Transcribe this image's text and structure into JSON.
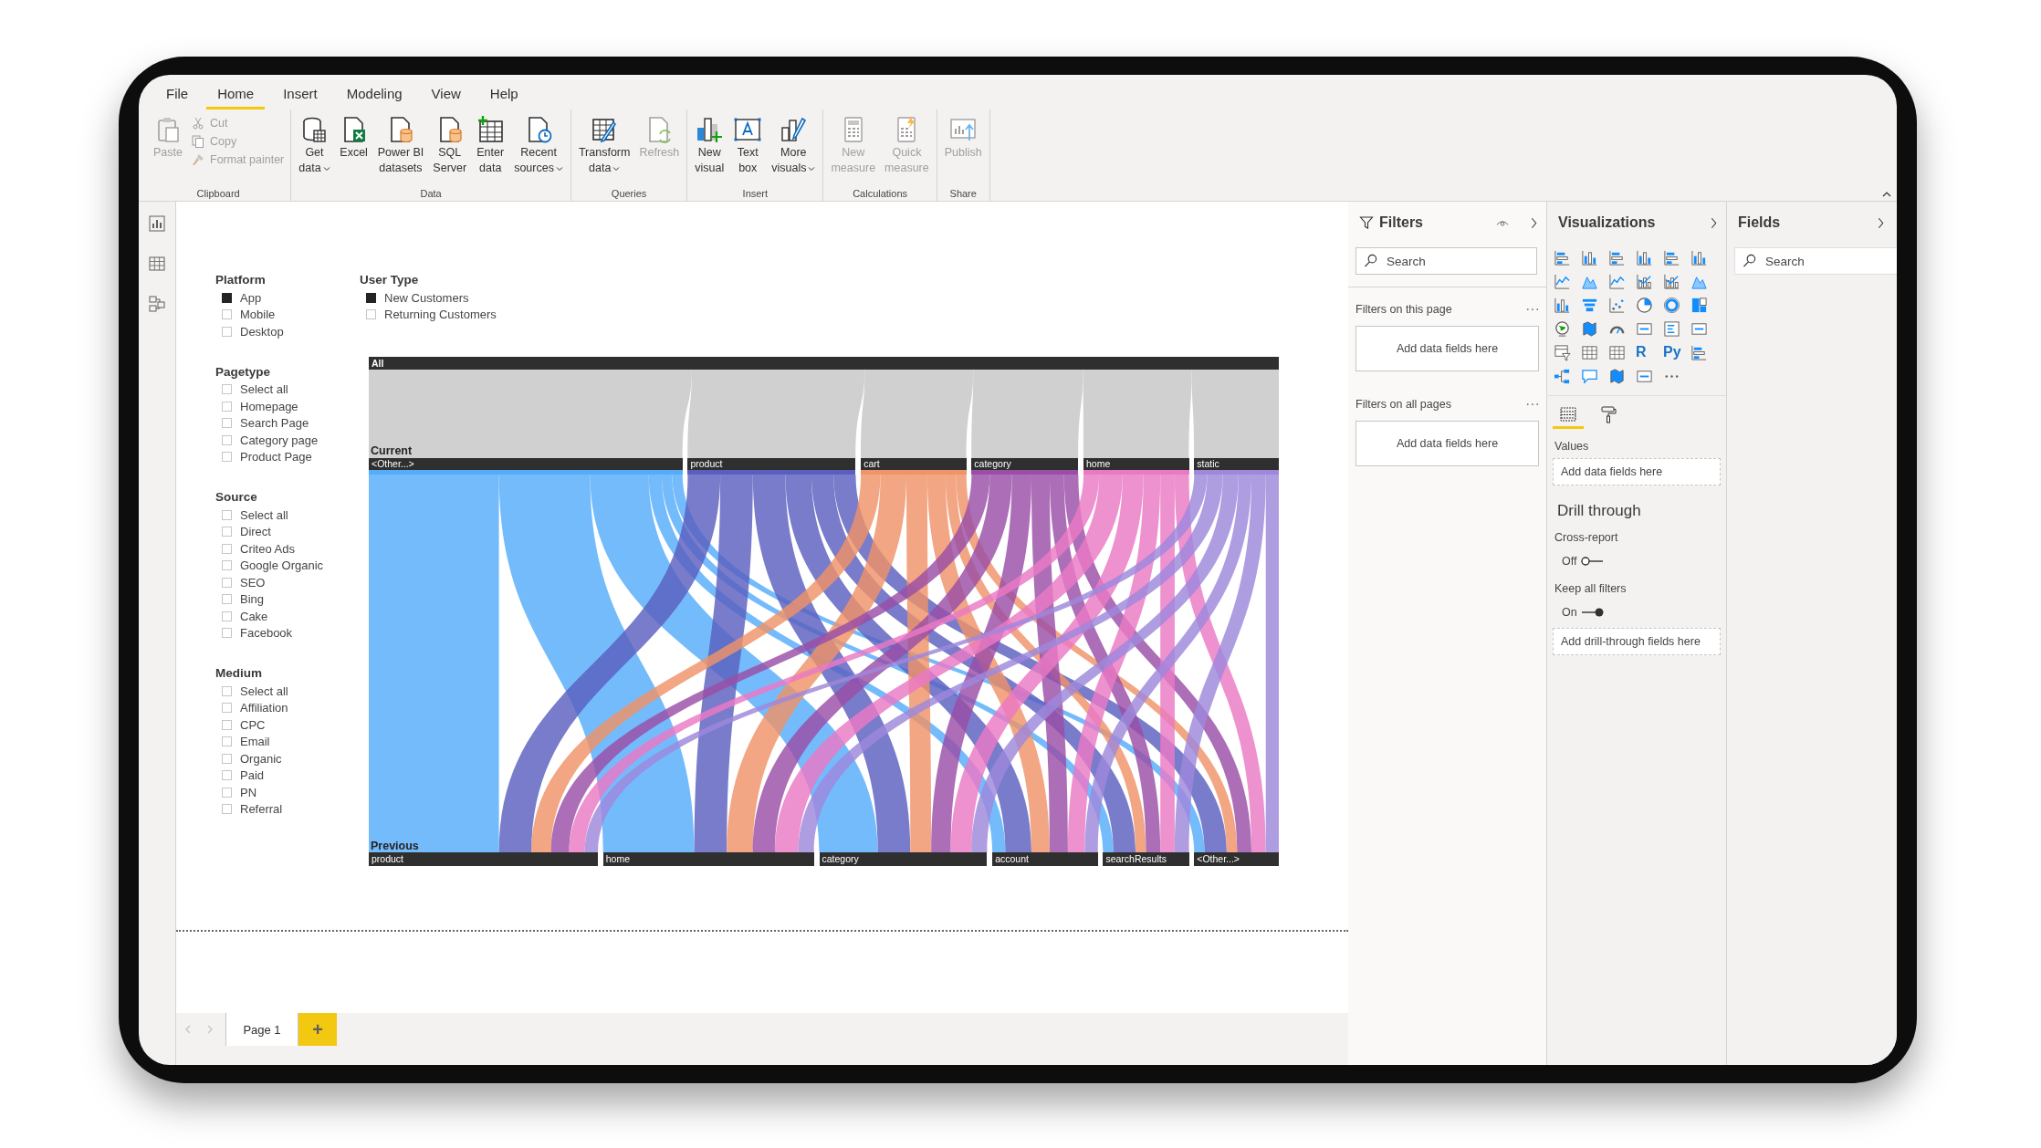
{
  "menu_tabs": [
    {
      "label": "File",
      "selected": false
    },
    {
      "label": "Home",
      "selected": true
    },
    {
      "label": "Insert",
      "selected": false
    },
    {
      "label": "Modeling",
      "selected": false
    },
    {
      "label": "View",
      "selected": false
    },
    {
      "label": "Help",
      "selected": false
    }
  ],
  "ribbon": {
    "groups": [
      {
        "label": "Clipboard",
        "buttons": [
          {
            "kind": "clipboard",
            "lines": [
              "Paste"
            ],
            "dropdown": false,
            "disabled": true
          }
        ],
        "small_buttons": [
          {
            "kind": "scissors",
            "label": "Cut",
            "disabled": true
          },
          {
            "kind": "copy",
            "label": "Copy",
            "disabled": true
          },
          {
            "kind": "paintbrush",
            "label": "Format painter",
            "disabled": true
          }
        ]
      },
      {
        "label": "Data",
        "buttons": [
          {
            "kind": "database",
            "lines": [
              "Get",
              "data"
            ],
            "dropdown": true,
            "disabled": false
          },
          {
            "kind": "spreadsheet",
            "lines": [
              "Excel"
            ],
            "dropdown": false,
            "disabled": false
          },
          {
            "kind": "document-database",
            "lines": [
              "Power BI",
              "datasets"
            ],
            "dropdown": false,
            "disabled": false
          },
          {
            "kind": "document-database",
            "lines": [
              "SQL",
              "Server"
            ],
            "dropdown": false,
            "disabled": false
          },
          {
            "kind": "table-plus",
            "lines": [
              "Enter",
              "data"
            ],
            "dropdown": false,
            "disabled": false
          },
          {
            "kind": "document-clock",
            "lines": [
              "Recent",
              "sources"
            ],
            "dropdown": true,
            "disabled": false
          }
        ]
      },
      {
        "label": "Queries",
        "buttons": [
          {
            "kind": "table-pencil",
            "lines": [
              "Transform",
              "data"
            ],
            "dropdown": true,
            "disabled": false
          },
          {
            "kind": "document-refresh",
            "lines": [
              "Refresh"
            ],
            "dropdown": false,
            "disabled": true
          }
        ]
      },
      {
        "label": "Insert",
        "buttons": [
          {
            "kind": "bar-chart-plus",
            "lines": [
              "New",
              "visual"
            ],
            "dropdown": false,
            "disabled": false
          },
          {
            "kind": "text-box",
            "lines": [
              "Text",
              "box"
            ],
            "dropdown": false,
            "disabled": false
          },
          {
            "kind": "chart-pencil",
            "lines": [
              "More",
              "visuals"
            ],
            "dropdown": true,
            "disabled": false
          }
        ]
      },
      {
        "label": "Calculations",
        "buttons": [
          {
            "kind": "calculator",
            "lines": [
              "New",
              "measure"
            ],
            "dropdown": false,
            "disabled": true
          },
          {
            "kind": "calculator-bolt",
            "lines": [
              "Quick",
              "measure"
            ],
            "dropdown": false,
            "disabled": true
          }
        ]
      },
      {
        "label": "Share",
        "buttons": [
          {
            "kind": "publish-chart",
            "lines": [
              "Publish"
            ],
            "dropdown": false,
            "disabled": true
          }
        ]
      }
    ]
  },
  "slicers": [
    {
      "title": "Platform",
      "items": [
        {
          "label": "App",
          "checked": true
        },
        {
          "label": "Mobile",
          "checked": false
        },
        {
          "label": "Desktop",
          "checked": false
        }
      ]
    },
    {
      "title": "User Type",
      "items": [
        {
          "label": "New Customers",
          "checked": true
        },
        {
          "label": "Returning Customers",
          "checked": false
        }
      ]
    },
    {
      "title": "Pagetype",
      "items": [
        {
          "label": "Select all",
          "checked": false
        },
        {
          "label": "Homepage",
          "checked": false
        },
        {
          "label": "Search Page",
          "checked": false
        },
        {
          "label": "Category page",
          "checked": false
        },
        {
          "label": "Product Page",
          "checked": false
        }
      ]
    },
    {
      "title": "Source",
      "items": [
        {
          "label": "Select all",
          "checked": false
        },
        {
          "label": "Direct",
          "checked": false
        },
        {
          "label": "Criteo Ads",
          "checked": false
        },
        {
          "label": "Google Organic",
          "checked": false
        },
        {
          "label": "SEO",
          "checked": false
        },
        {
          "label": "Bing",
          "checked": false
        },
        {
          "label": "Cake",
          "checked": false
        },
        {
          "label": "Facebook",
          "checked": false
        }
      ]
    },
    {
      "title": "Medium",
      "items": [
        {
          "label": "Select all",
          "checked": false
        },
        {
          "label": "Affiliation",
          "checked": false
        },
        {
          "label": "CPC",
          "checked": false
        },
        {
          "label": "Email",
          "checked": false
        },
        {
          "label": "Organic",
          "checked": false
        },
        {
          "label": "Paid",
          "checked": false
        },
        {
          "label": "PN",
          "checked": false
        },
        {
          "label": "Referral",
          "checked": false
        }
      ]
    }
  ],
  "sankey": {
    "top_label": "All",
    "current_label": "Current",
    "previous_label": "Previous",
    "current_nodes": [
      {
        "label": "<Other...>",
        "color": "#55acfb"
      },
      {
        "label": "product",
        "color": "#5a5fbf"
      },
      {
        "label": "cart",
        "color": "#ef9368"
      },
      {
        "label": "category",
        "color": "#9a4ea6"
      },
      {
        "label": "home",
        "color": "#ea79c4"
      },
      {
        "label": "static",
        "color": "#9d88dc"
      }
    ],
    "previous_nodes": [
      {
        "label": "product"
      },
      {
        "label": "home"
      },
      {
        "label": "category"
      },
      {
        "label": "account"
      },
      {
        "label": "searchResults"
      },
      {
        "label": "<Other...>"
      }
    ]
  },
  "page_tabs": {
    "tabs": [
      {
        "label": "Page 1",
        "selected": true
      }
    ],
    "add_label": "+"
  },
  "filters": {
    "title": "Filters",
    "search_placeholder": "Search",
    "sections": [
      {
        "title": "Filters on this page",
        "drop_hint": "Add data fields here"
      },
      {
        "title": "Filters on all pages",
        "drop_hint": "Add data fields here"
      }
    ]
  },
  "visualizations": {
    "title": "Visualizations",
    "visual_types": [
      {
        "kind": "horizontal-bar-chart"
      },
      {
        "kind": "column-chart"
      },
      {
        "kind": "horizontal-bar-chart"
      },
      {
        "kind": "column-chart"
      },
      {
        "kind": "horizontal-bar-chart"
      },
      {
        "kind": "column-chart"
      },
      {
        "kind": "line-chart"
      },
      {
        "kind": "area-chart"
      },
      {
        "kind": "line-chart"
      },
      {
        "kind": "combo-chart"
      },
      {
        "kind": "combo-chart"
      },
      {
        "kind": "area-chart"
      },
      {
        "kind": "column-chart"
      },
      {
        "kind": "funnel"
      },
      {
        "kind": "scatter-chart"
      },
      {
        "kind": "pie-chart"
      },
      {
        "kind": "donut-chart"
      },
      {
        "kind": "treemap"
      },
      {
        "kind": "globe"
      },
      {
        "kind": "map"
      },
      {
        "kind": "gauge"
      },
      {
        "kind": "card"
      },
      {
        "kind": "list"
      },
      {
        "kind": "card"
      },
      {
        "kind": "filter-table"
      },
      {
        "kind": "table"
      },
      {
        "kind": "table"
      },
      {
        "kind": "text",
        "label": "R"
      },
      {
        "kind": "text",
        "label": "Py"
      },
      {
        "kind": "horizontal-bar-chart"
      },
      {
        "kind": "tree"
      },
      {
        "kind": "speech-bubble"
      },
      {
        "kind": "map"
      },
      {
        "kind": "card"
      },
      {
        "kind": "more"
      }
    ],
    "tabs": [
      {
        "kind": "fields",
        "selected": true
      },
      {
        "kind": "format",
        "selected": false
      }
    ],
    "values_label": "Values",
    "values_hint": "Add data fields here",
    "drill_through": {
      "title": "Drill through",
      "toggles": [
        {
          "label": "Cross-report",
          "state_label": "Off",
          "on": false
        },
        {
          "label": "Keep all filters",
          "state_label": "On",
          "on": true
        }
      ],
      "hint": "Add drill-through fields here"
    }
  },
  "fields": {
    "title": "Fields",
    "search_placeholder": "Search"
  }
}
